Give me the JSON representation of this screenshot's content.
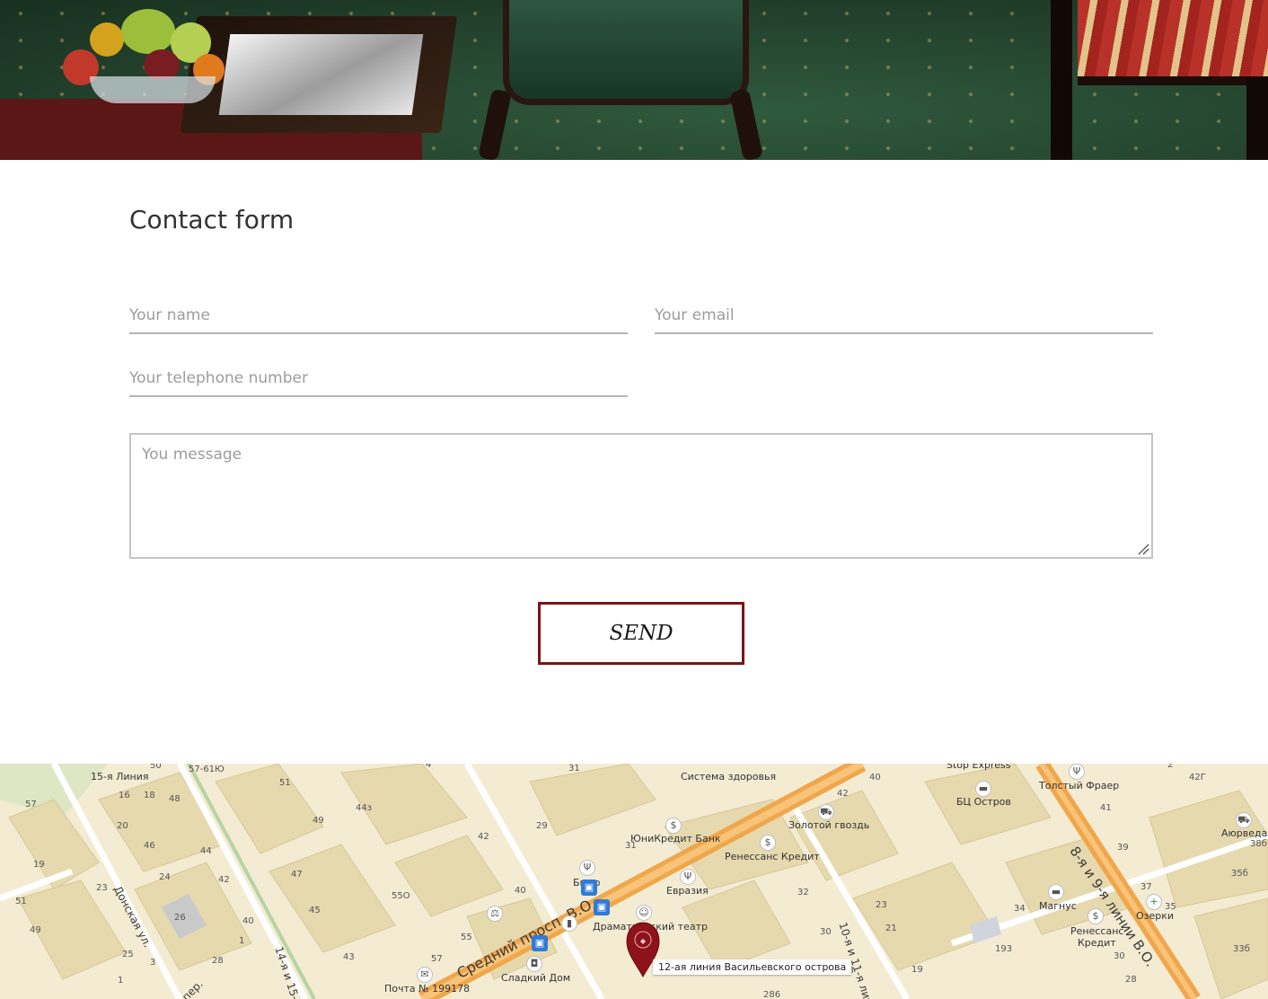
{
  "contact_form": {
    "title": "Contact form",
    "name_placeholder": "Your name",
    "email_placeholder": "Your email",
    "phone_placeholder": "Your telephone number",
    "message_placeholder": "You message",
    "send_label": "SEND"
  },
  "colors": {
    "accent": "#7a1418",
    "field_line": "#b5b5b5",
    "placeholder": "#9c9c9c"
  },
  "map": {
    "marker_caption": "12-ая линия Васильевского острова",
    "streets": {
      "sredniy": "Средний просп. В.О.",
      "line_8_9": "8-я и 9-я линии В.О.",
      "line_10_11": "10-я и 11-я линии",
      "line_14_15": "14-я и 15-я линии",
      "donskaya": "Донская ул.",
      "per": "пер."
    },
    "places": {
      "line15": "15-я Линия",
      "sistema": "Система здоровья",
      "zolotoy": "Золотой гвоздь",
      "unicredit": "ЮниКредит Банк",
      "renessans1": "Ренессанс Кредит",
      "evraziya": "Евразия",
      "byuro": "Бюро",
      "dramtheatre": "Драматический театр",
      "sladkiy": "Сладкий Дом",
      "pochta": "Почта № 199178",
      "stop_express": "Stop Express",
      "bc_ostrov": "БЦ Остров",
      "tolstyy": "Толстый Фраер",
      "magnus": "Магнус",
      "renessans2a": "Ренессанс",
      "renessans2b": "Кредит",
      "ozerki": "Озерки",
      "ayurveda": "Аюрведа"
    },
    "house_numbers": [
      "57",
      "19",
      "51",
      "49",
      "16",
      "18",
      "48",
      "20",
      "46",
      "44",
      "24",
      "42",
      "23",
      "25",
      "28",
      "26",
      "40",
      "47",
      "45",
      "43",
      "3",
      "1",
      "44з",
      "49",
      "55О",
      "42",
      "40",
      "55",
      "57",
      "51",
      "29",
      "31",
      "40",
      "42",
      "32",
      "30",
      "28",
      "23",
      "21",
      "19",
      "41",
      "39",
      "37",
      "35",
      "34",
      "30",
      "28",
      "193",
      "35б",
      "33б",
      "38б",
      "42Г",
      "57-61Ю",
      "50",
      "31",
      "4",
      "2",
      "286",
      "1"
    ]
  }
}
